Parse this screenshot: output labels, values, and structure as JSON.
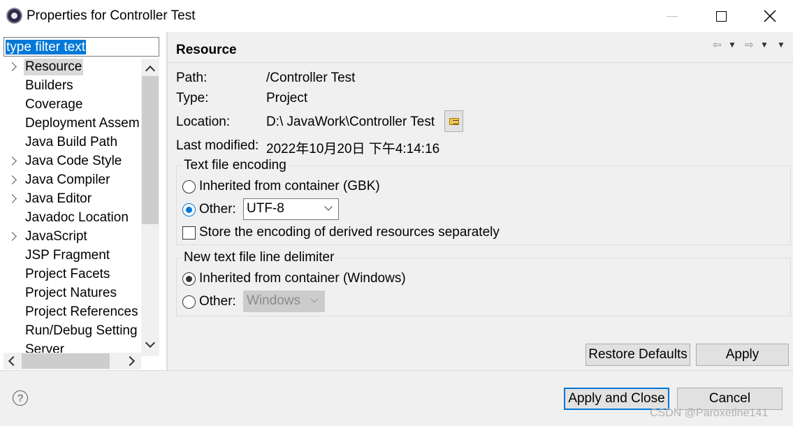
{
  "window": {
    "title": "Properties for Controller Test",
    "icon": "eclipse-gear-icon"
  },
  "filter": {
    "value": "type filter text"
  },
  "tree": {
    "items": [
      {
        "label": "Resource",
        "expandable": true,
        "selected": true
      },
      {
        "label": "Builders",
        "expandable": false
      },
      {
        "label": "Coverage",
        "expandable": false
      },
      {
        "label": "Deployment Assem",
        "expandable": false
      },
      {
        "label": "Java Build Path",
        "expandable": false
      },
      {
        "label": "Java Code Style",
        "expandable": true
      },
      {
        "label": "Java Compiler",
        "expandable": true
      },
      {
        "label": "Java Editor",
        "expandable": true
      },
      {
        "label": "Javadoc Location",
        "expandable": false
      },
      {
        "label": "JavaScript",
        "expandable": true
      },
      {
        "label": "JSP Fragment",
        "expandable": false
      },
      {
        "label": "Project Facets",
        "expandable": false
      },
      {
        "label": "Project Natures",
        "expandable": false
      },
      {
        "label": "Project References",
        "expandable": false
      },
      {
        "label": "Run/Debug Setting",
        "expandable": false
      },
      {
        "label": "Server",
        "expandable": false
      }
    ]
  },
  "page": {
    "title": "Resource",
    "path_label": "Path:",
    "path_value": "/Controller Test",
    "type_label": "Type:",
    "type_value": "Project",
    "location_label": "Location:",
    "location_value": "D:\\ JavaWork\\Controller Test",
    "modified_label": "Last modified:",
    "modified_value": "2022年10月20日 下午4:14:16"
  },
  "encoding": {
    "group_title": "Text file encoding",
    "inherited_label": "Inherited from container (GBK)",
    "other_label": "Other:",
    "other_value": "UTF-8",
    "store_label": "Store the encoding of derived resources separately"
  },
  "delimiter": {
    "group_title": "New text file line delimiter",
    "inherited_label": "Inherited from container (Windows)",
    "other_label": "Other:",
    "other_value": "Windows"
  },
  "buttons": {
    "restore_defaults": "Restore Defaults",
    "apply": "Apply",
    "apply_and_close": "Apply and Close",
    "cancel": "Cancel"
  },
  "footer": {
    "help_glyph": "?",
    "watermark": "CSDN @Paroxetine141"
  },
  "colors": {
    "accent": "#0078d7",
    "pane_bg": "#f0f0f0",
    "selection_bg": "#d9d9d9"
  }
}
